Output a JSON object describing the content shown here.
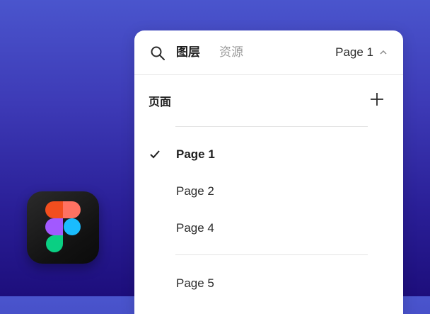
{
  "header": {
    "tabs": [
      {
        "label": "图层",
        "active": true
      },
      {
        "label": "资源",
        "active": false
      }
    ],
    "current_page": "Page 1"
  },
  "pages_section": {
    "title": "页面"
  },
  "pages": [
    {
      "label": "Page 1",
      "selected": true
    },
    {
      "label": "Page 2",
      "selected": false
    },
    {
      "label": "Page 4",
      "selected": false
    },
    {
      "label": "Page 5",
      "selected": false
    }
  ],
  "icons": {
    "search": "search-icon",
    "chevron": "chevron-up-icon",
    "add": "plus-icon",
    "check": "check-icon",
    "app": "figma-logo-icon"
  },
  "colors": {
    "background_top": "#4a55cd",
    "background_bottom": "#1d0e7c",
    "panel": "#ffffff",
    "text_primary": "#1e1e1e",
    "text_muted": "#9a9a9a"
  }
}
